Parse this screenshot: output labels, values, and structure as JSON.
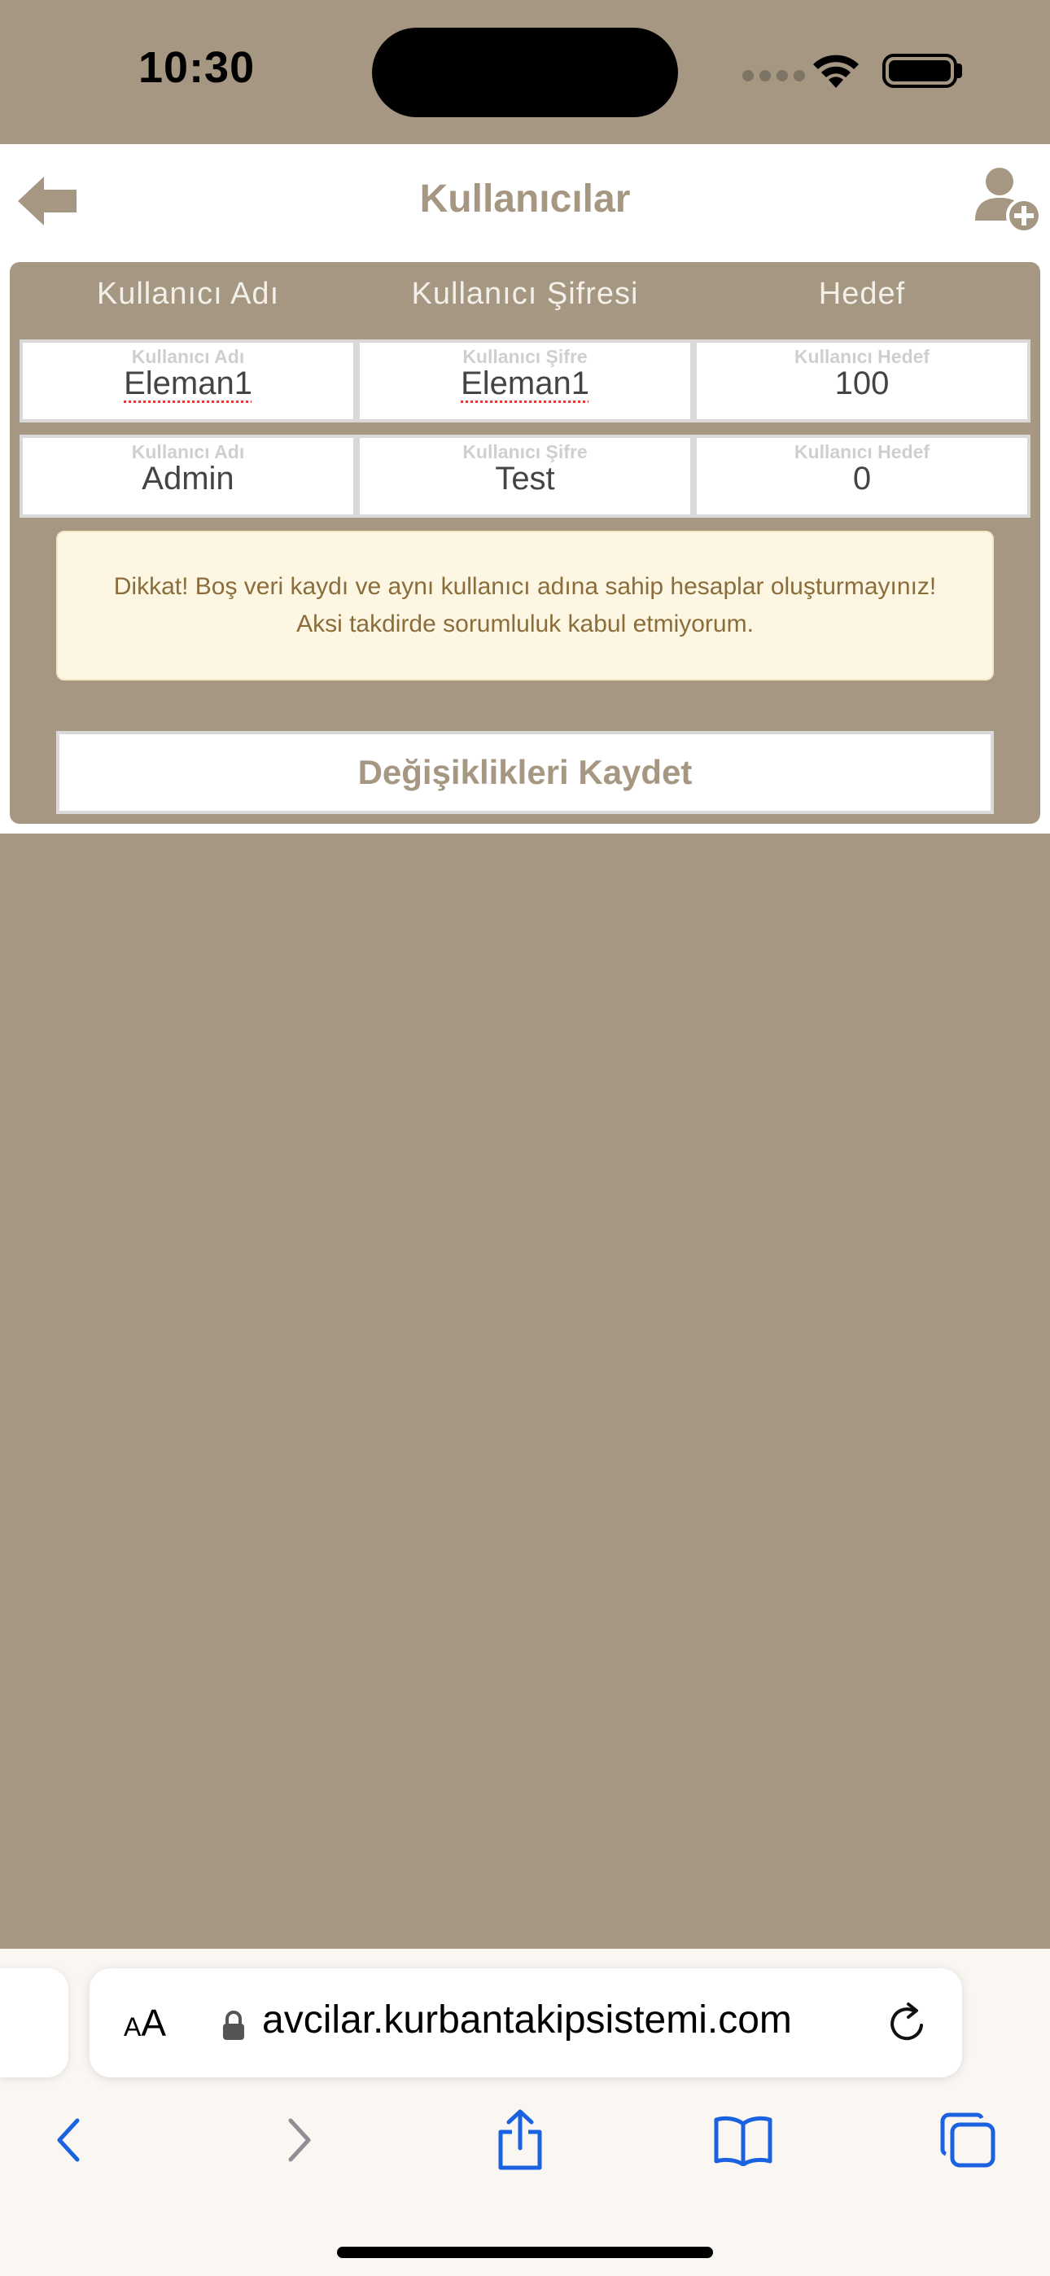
{
  "status_bar": {
    "time": "10:30"
  },
  "header": {
    "title": "Kullanıcılar"
  },
  "table": {
    "columns": [
      "Kullanıcı Adı",
      "Kullanıcı Şifresi",
      "Hedef"
    ],
    "rows": [
      {
        "username_label": "Kullanıcı Adı",
        "username": "Eleman1",
        "password_label": "Kullanıcı Şifre",
        "password": "Eleman1",
        "target_label": "Kullanıcı Hedef",
        "target": "100"
      },
      {
        "username_label": "Kullanıcı Adı",
        "username": "Admin",
        "password_label": "Kullanıcı Şifre",
        "password": "Test",
        "target_label": "Kullanıcı Hedef",
        "target": "0"
      }
    ]
  },
  "alert": {
    "line1": "Dikkat! Boş veri kaydı ve aynı kullanıcı adına sahip hesaplar oluşturmayınız!",
    "line2": "Aksi takdirde sorumluluk kabul etmiyorum."
  },
  "save_button": {
    "label": "Değişiklikleri Kaydet"
  },
  "browser": {
    "aa_small": "A",
    "aa_large": "A",
    "url": "avcilar.kurbantakipsistemi.com"
  },
  "colors": {
    "brand": "#a69782",
    "alert_bg": "#fdf6e3",
    "alert_text": "#8a6d3b",
    "toolbar_blue": "#1a62e0"
  }
}
